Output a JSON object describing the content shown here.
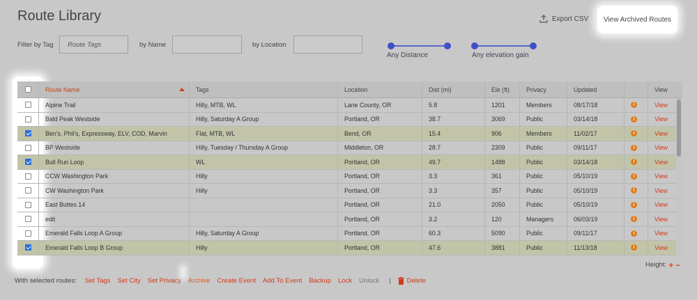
{
  "header": {
    "title": "Route Library",
    "export_label": "Export CSV",
    "archived_label": "View Archived Routes"
  },
  "filters": {
    "tag_label": "Filter by Tag",
    "tag_placeholder": "Route Tags",
    "name_label": "by Name",
    "name_value": "",
    "location_label": "by Location",
    "location_value": "",
    "distance_label": "Any Distance",
    "elevation_label": "Any elevation gain"
  },
  "table": {
    "columns": [
      "Route Name",
      "Tags",
      "Location",
      "Dist (mi)",
      "Ele (ft)",
      "Privacy",
      "Updated",
      "",
      "View"
    ],
    "rows": [
      {
        "selected": false,
        "name": "Alpine Trail",
        "tags": "Hilly, MTB, WL",
        "location": "Lane County, OR",
        "dist": "5.8",
        "ele": "1201",
        "privacy": "Members",
        "updated": "08/17/18",
        "view": "View"
      },
      {
        "selected": false,
        "name": "Bald Peak Westside",
        "tags": "Hilly, Saturday A Group",
        "location": "Portland, OR",
        "dist": "38.7",
        "ele": "3069",
        "privacy": "Public",
        "updated": "03/14/18",
        "view": "View"
      },
      {
        "selected": true,
        "name": "Ben's, Phil's, Expressway, ELV, COD, Marvin",
        "tags": "Flat, MTB, WL",
        "location": "Bend, OR",
        "dist": "15.4",
        "ele": "906",
        "privacy": "Members",
        "updated": "11/02/17",
        "view": "View"
      },
      {
        "selected": false,
        "name": "BP Westside",
        "tags": "Hilly, Tuesday / Thursday A Group",
        "location": "Middleton, OR",
        "dist": "28.7",
        "ele": "2309",
        "privacy": "Public",
        "updated": "09/11/17",
        "view": "View"
      },
      {
        "selected": true,
        "name": "Bull Run Loop",
        "tags": "WL",
        "location": "Portland, OR",
        "dist": "49.7",
        "ele": "1488",
        "privacy": "Public",
        "updated": "03/14/18",
        "view": "View"
      },
      {
        "selected": false,
        "name": "CCW Washington Park",
        "tags": "Hilly",
        "location": "Portland, OR",
        "dist": "3.3",
        "ele": "361",
        "privacy": "Public",
        "updated": "05/10/19",
        "view": "View"
      },
      {
        "selected": false,
        "name": "CW Washington Park",
        "tags": "Hilly",
        "location": "Portland, OR",
        "dist": "3.3",
        "ele": "357",
        "privacy": "Public",
        "updated": "05/10/19",
        "view": "View"
      },
      {
        "selected": false,
        "name": "East Buttes 14",
        "tags": "",
        "location": "Portland, OR",
        "dist": "21.0",
        "ele": "2050",
        "privacy": "Public",
        "updated": "05/10/19",
        "view": "View"
      },
      {
        "selected": false,
        "name": "edit",
        "tags": "",
        "location": "Portland, OR",
        "dist": "3.2",
        "ele": "120",
        "privacy": "Managers",
        "updated": "06/03/19",
        "view": "View"
      },
      {
        "selected": false,
        "name": "Emerald Falls Loop A Group",
        "tags": "Hilly, Saturday A Group",
        "location": "Portland, OR",
        "dist": "60.3",
        "ele": "5090",
        "privacy": "Public",
        "updated": "09/11/17",
        "view": "View"
      },
      {
        "selected": true,
        "name": "Emerald Falls Loop B Group",
        "tags": "Hilly",
        "location": "Portland, OR",
        "dist": "47.6",
        "ele": "3881",
        "privacy": "Public",
        "updated": "11/13/18",
        "view": "View"
      }
    ]
  },
  "height_label": "Height:",
  "actions": {
    "prefix": "With selected routes:",
    "items": [
      "Set Tags",
      "Set City",
      "Set Privacy",
      "Archive",
      "Create Event",
      "Add To Event",
      "Backup",
      "Lock",
      "Unlock"
    ],
    "separator": "|",
    "delete_label": "Delete"
  },
  "colors": {
    "accent": "#cf3a1c",
    "slider": "#3f4fc7",
    "selected_row": "#c2c4a8"
  },
  "icons": [
    "export-icon",
    "info-icon",
    "trash-icon",
    "sort-asc-icon",
    "plus-icon",
    "minus-icon"
  ]
}
